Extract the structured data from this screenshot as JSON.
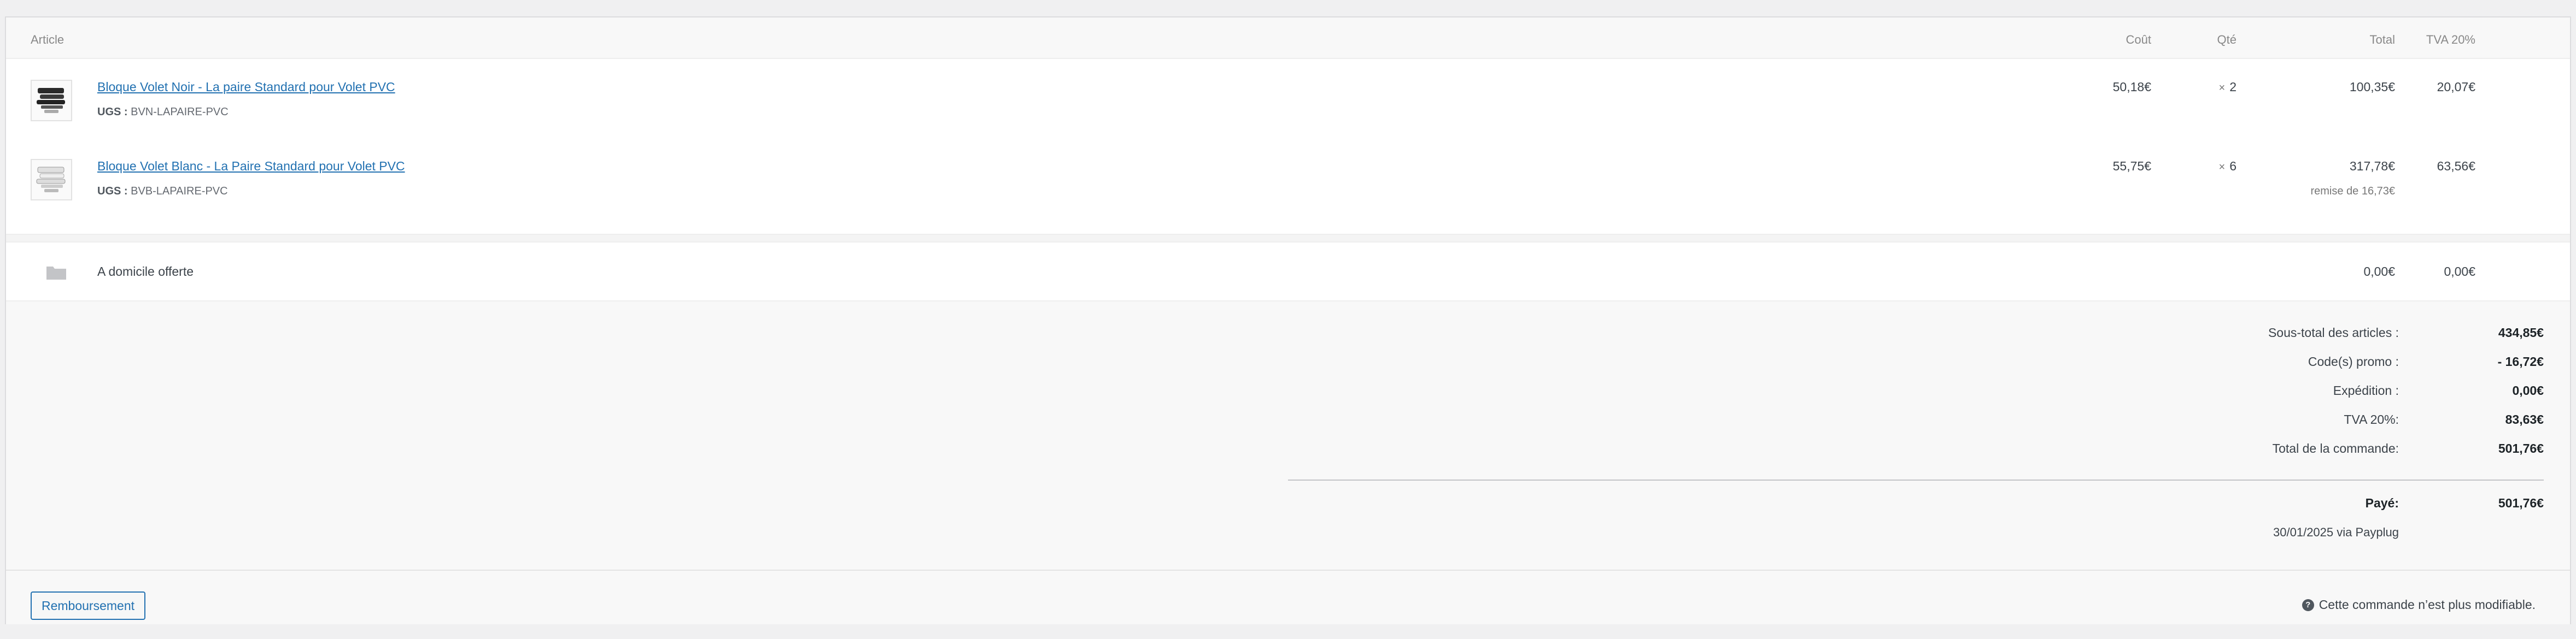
{
  "columns": {
    "article": "Article",
    "cost": "Coût",
    "qty": "Qté",
    "total": "Total",
    "tax": "TVA 20%"
  },
  "items": [
    {
      "name": "Bloque Volet Noir - La paire Standard pour Volet PVC",
      "sku_label": "UGS :",
      "sku": "BVN-LAPAIRE-PVC",
      "cost": "50,18€",
      "qty_prefix": "×",
      "qty": "2",
      "total": "100,35€",
      "tax": "20,07€",
      "discount": "",
      "thumb_icon": "product-thumbnail-black-icon"
    },
    {
      "name": "Bloque Volet Blanc - La Paire Standard pour Volet PVC",
      "sku_label": "UGS :",
      "sku": "BVB-LAPAIRE-PVC",
      "cost": "55,75€",
      "qty_prefix": "×",
      "qty": "6",
      "total": "317,78€",
      "tax": "63,56€",
      "discount": "remise de 16,73€",
      "thumb_icon": "product-thumbnail-white-icon"
    }
  ],
  "shipping": {
    "name": "A domicile offerte",
    "total": "0,00€",
    "tax": "0,00€",
    "icon": "shipping-icon"
  },
  "totals": {
    "subtotal_label": "Sous-total des articles :",
    "subtotal_value": "434,85€",
    "promo_label": "Code(s) promo :",
    "promo_value": "- 16,72€",
    "shipping_label": "Expédition :",
    "shipping_value": "0,00€",
    "tax_label": "TVA 20%:",
    "tax_value": "83,63€",
    "order_total_label": "Total de la commande:",
    "order_total_value": "501,76€",
    "paid_label": "Payé:",
    "paid_value": "501,76€",
    "paid_meta": "30/01/2025 via Payplug"
  },
  "footer": {
    "refund_label": "Remboursement",
    "notice": "Cette commande n’est plus modifiable.",
    "notice_icon": "help-icon"
  }
}
